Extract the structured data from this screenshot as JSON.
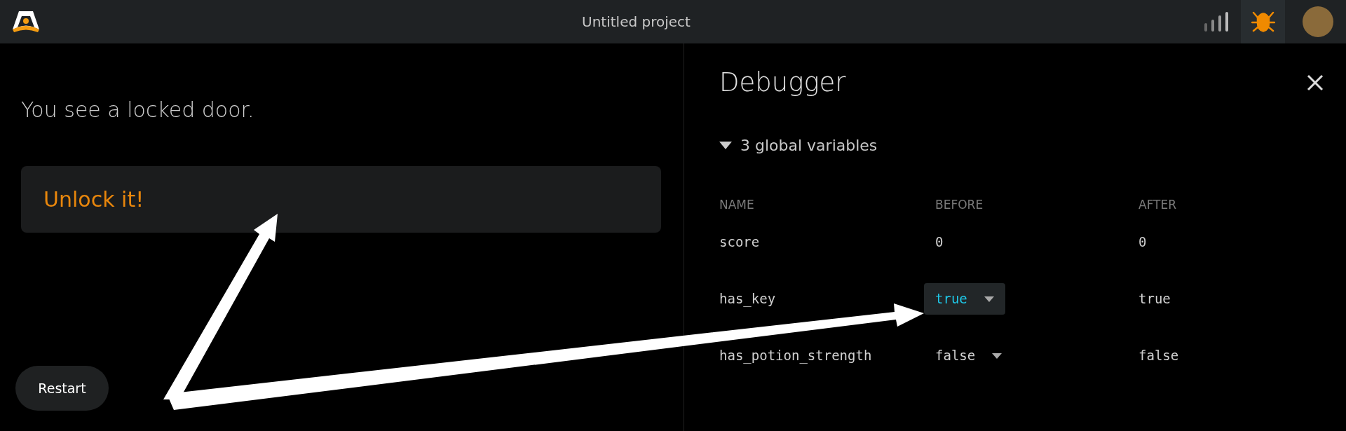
{
  "header": {
    "title": "Untitled project"
  },
  "story": {
    "text": "You see a locked door.",
    "choices": [
      "Unlock it!"
    ],
    "restart": "Restart"
  },
  "debugger": {
    "title": "Debugger",
    "section": {
      "label": "3 global variables",
      "expanded": true
    },
    "columns": [
      "NAME",
      "BEFORE",
      "AFTER"
    ],
    "rows": [
      {
        "name": "score",
        "before": "0",
        "after": "0",
        "kind": "plain"
      },
      {
        "name": "has_key",
        "before": "true",
        "after": "true",
        "kind": "dropdown",
        "selected": true
      },
      {
        "name": "has_potion_strength",
        "before": "false",
        "after": "false",
        "kind": "dropdown",
        "selected": false
      }
    ]
  }
}
